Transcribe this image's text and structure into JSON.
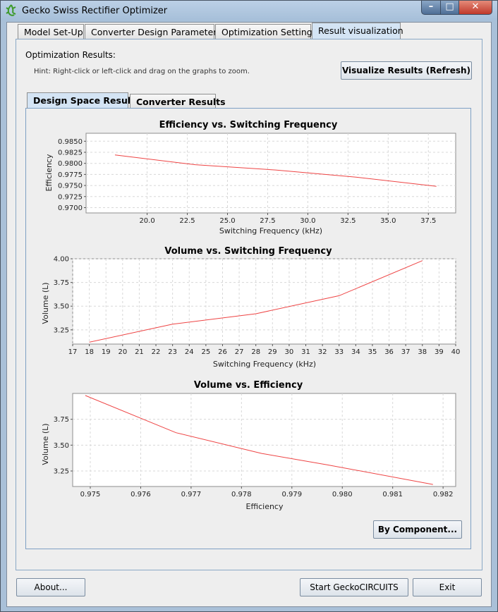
{
  "window": {
    "title": "Gecko Swiss Rectifier Optimizer"
  },
  "main_tabs": [
    "Model Set-Up",
    "Converter Design Parameters",
    "Optimization Settings",
    "Result visualization"
  ],
  "results": {
    "heading": "Optimization Results:",
    "hint": "Hint: Right-click or left-click and drag on the graphs to zoom.",
    "refresh_label": "Visualize Results (Refresh)"
  },
  "sub_tabs": [
    "Design Space Results",
    "Converter Results"
  ],
  "by_component_label": "By Component...",
  "footer": {
    "about_label": "About...",
    "start_label": "Start GeckoCIRCUITS",
    "exit_label": "Exit"
  },
  "colors": {
    "series": "#ee4444",
    "active_tab": "#d4e4f4",
    "window_frame": "#a9c0d8"
  },
  "chart_data": [
    {
      "type": "line",
      "title": "Efficiency vs. Switching Frequency",
      "xlabel": "Switching Frequency (kHz)",
      "ylabel": "Efficiency",
      "x": [
        18,
        23,
        28,
        33,
        38
      ],
      "series": [
        {
          "values": [
            0.9819,
            0.9797,
            0.9785,
            0.9769,
            0.9748
          ]
        }
      ],
      "xlim": [
        16.2,
        39.2
      ],
      "ylim": [
        0.9688,
        0.9868
      ],
      "xticks": [
        "20.0",
        "22.5",
        "25.0",
        "27.5",
        "30.0",
        "32.5",
        "35.0",
        "37.5"
      ],
      "yticks": [
        "0.9850",
        "0.9825",
        "0.9800",
        "0.9775",
        "0.9750",
        "0.9725",
        "0.9700"
      ],
      "grid": true
    },
    {
      "type": "line",
      "title": "Volume vs. Switching Frequency",
      "xlabel": "Switching Frequency (kHz)",
      "ylabel": "Volume (L)",
      "x": [
        18,
        23,
        28,
        33,
        38
      ],
      "series": [
        {
          "values": [
            3.12,
            3.31,
            3.42,
            3.61,
            3.98
          ]
        }
      ],
      "xlim": [
        17,
        40
      ],
      "ylim": [
        3.1,
        4.0
      ],
      "xticks": [
        "17",
        "18",
        "19",
        "20",
        "21",
        "22",
        "23",
        "24",
        "25",
        "26",
        "27",
        "28",
        "29",
        "30",
        "31",
        "32",
        "33",
        "34",
        "35",
        "36",
        "37",
        "38",
        "39",
        "40"
      ],
      "yticks": [
        "4.00",
        "3.75",
        "3.50",
        "3.25"
      ],
      "grid": true
    },
    {
      "type": "line",
      "title": "Volume vs. Efficiency",
      "xlabel": "Efficiency",
      "ylabel": "Volume (L)",
      "x": [
        0.9749,
        0.9767,
        0.9784,
        0.9797,
        0.9818
      ],
      "series": [
        {
          "values": [
            3.98,
            3.62,
            3.42,
            3.31,
            3.12
          ]
        }
      ],
      "xlim": [
        0.97465,
        0.98225
      ],
      "ylim": [
        3.1,
        4.0
      ],
      "xticks": [
        "0.975",
        "0.976",
        "0.977",
        "0.978",
        "0.979",
        "0.980",
        "0.981",
        "0.982"
      ],
      "yticks": [
        "3.75",
        "3.50",
        "3.25"
      ],
      "grid": true
    }
  ]
}
